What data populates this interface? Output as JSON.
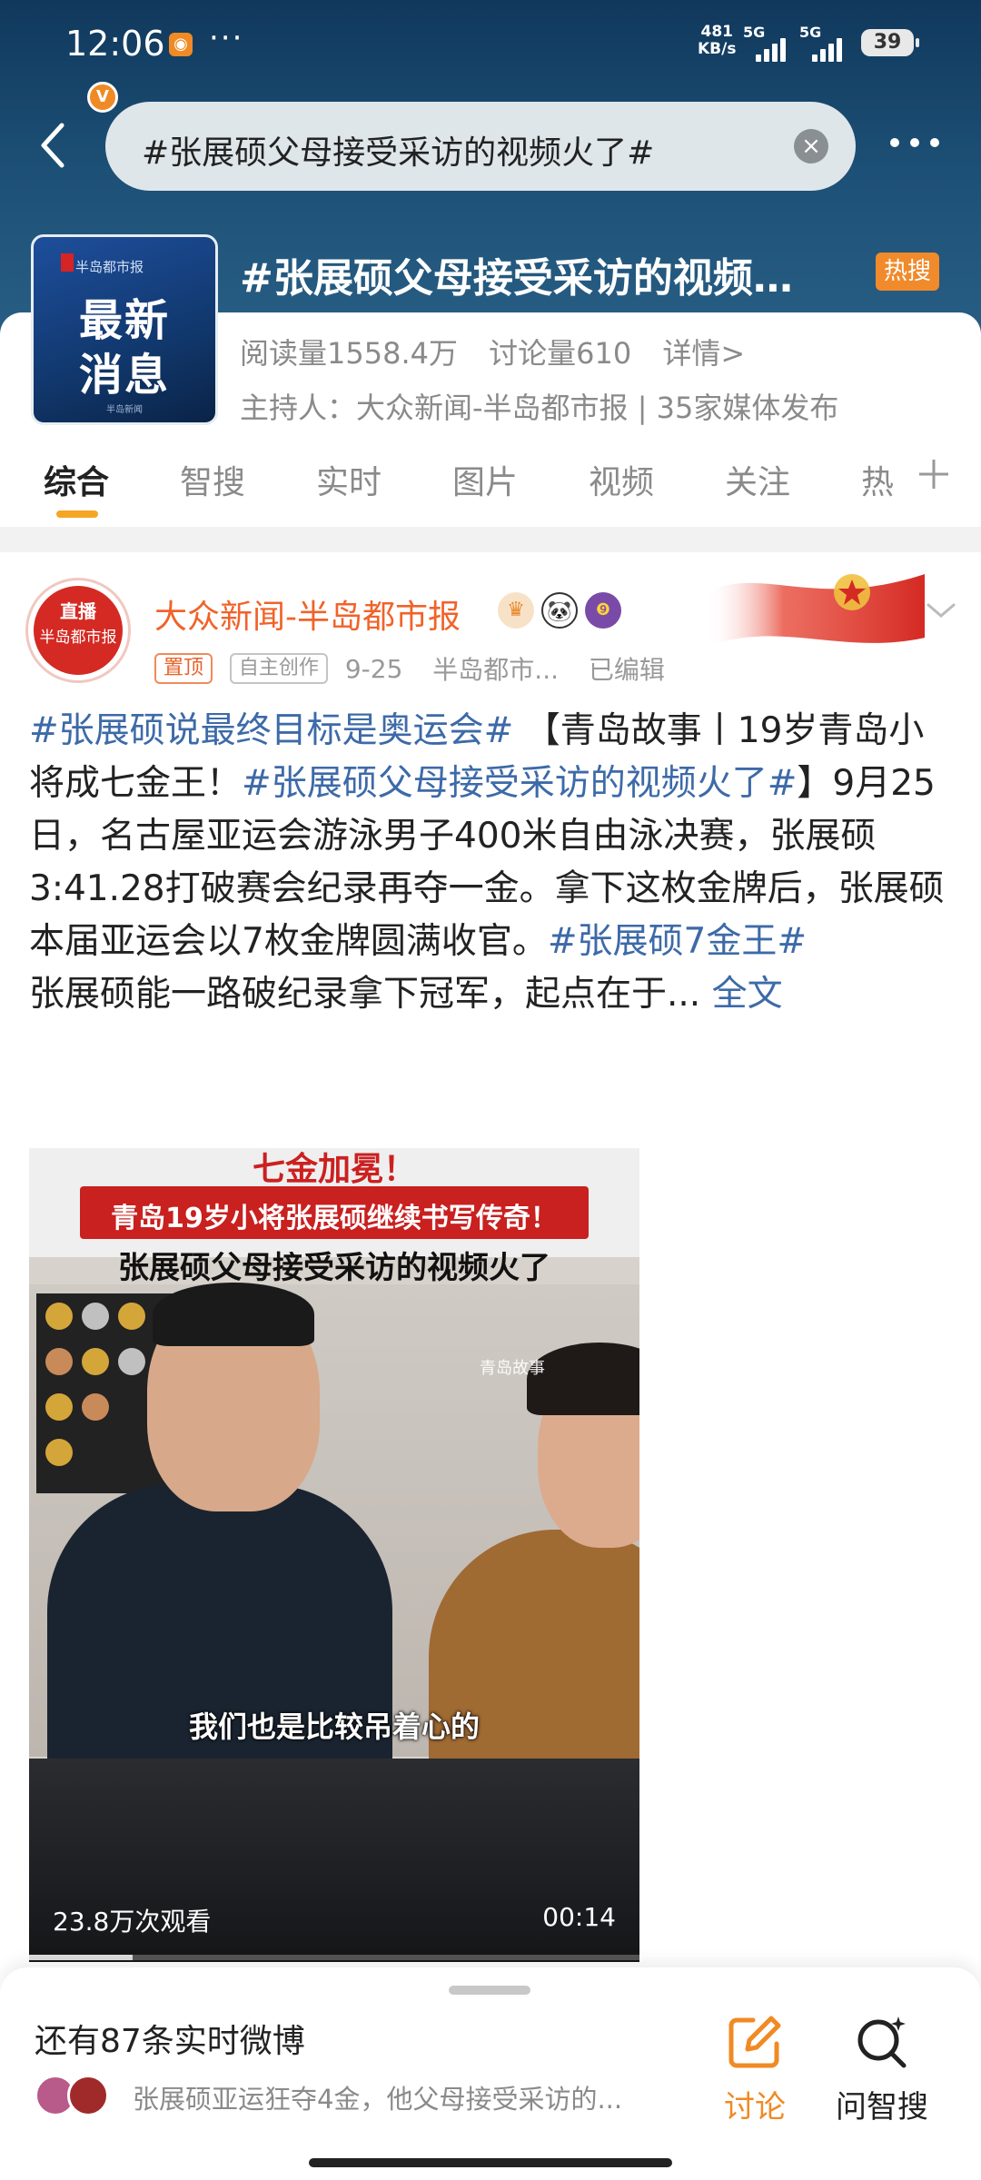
{
  "status_bar": {
    "time": "12:06",
    "dots": "···",
    "speed_value": "481",
    "speed_unit": "KB/s",
    "network1": "5G",
    "network2": "5G",
    "battery": "39"
  },
  "search": {
    "query": "#张展硕父母接受采访的视频火了#",
    "clear_icon": "clear-icon"
  },
  "topic": {
    "logo": {
      "top": "半岛都市报",
      "line1": "最新",
      "line2": "消息",
      "bottom": "半岛新闻"
    },
    "title": "#张展硕父母接受采访的视频…",
    "hot_badge": "热搜",
    "reads": "阅读量1558.4万",
    "discussions": "讨论量610",
    "details": "详情>",
    "host": "主持人：大众新闻-半岛都市报 | 35家媒体发布"
  },
  "tabs": [
    {
      "label": "综合",
      "active": true
    },
    {
      "label": "智搜",
      "active": false
    },
    {
      "label": "实时",
      "active": false
    },
    {
      "label": "图片",
      "active": false
    },
    {
      "label": "视频",
      "active": false
    },
    {
      "label": "关注",
      "active": false
    },
    {
      "label": "热",
      "active": false
    }
  ],
  "post": {
    "avatar": {
      "live": "直播",
      "name": "半岛都市报",
      "verified": "V"
    },
    "author": "大众新闻-半岛都市报",
    "pinned": "置顶",
    "original": "自主创作",
    "date": "9-25",
    "source": "半岛都市...",
    "edited": "已编辑",
    "body": {
      "tag1": "#张展硕说最终目标是奥运会#",
      "text1": " 【青岛故事丨19岁青岛小将成七金王！",
      "tag2": "#张展硕父母接受采访的视频火了#",
      "text2": "】9月25日，名古屋亚运会游泳男子400米自由泳决赛，张展硕3:41.28打破赛会纪录再夺一金。拿下这枚金牌后，张展硕本届亚运会以7枚金牌圆满收官。",
      "tag3": "#张展硕7金王#",
      "text3": "张展硕能一路破纪录拿下冠军，起点在于...",
      "fulltext": "全文"
    },
    "video": {
      "title_top": "七金加冕！",
      "red_banner": "青岛19岁小将张展硕继续书写传奇！",
      "title_main": "张展硕父母接受采访的视频火了",
      "watermark": "青岛故事",
      "caption": "我们也是比较吊着心的",
      "views": "23.8万次观看",
      "duration": "00:14",
      "progress": 0.17
    }
  },
  "bottom_bar": {
    "realtime_title": "还有87条实时微博",
    "realtime_preview": "张展硕亚运狂夺4金，他父母接受采访的...",
    "discuss_label": "讨论",
    "ask_label": "问智搜"
  },
  "colors": {
    "header_bg": "#1d5076",
    "accent_orange": "#f08a24",
    "link_blue": "#3d6aa8",
    "author_orange": "#f0632a",
    "tab_underline": "#f5a623"
  }
}
